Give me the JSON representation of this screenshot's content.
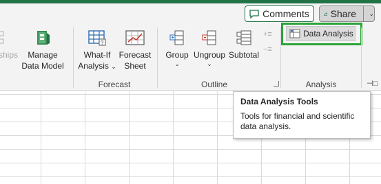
{
  "topbar": {
    "comments_label": "Comments",
    "share_label": "Share"
  },
  "ribbon": {
    "partial_label": "ships",
    "manage_line1": "Manage",
    "manage_line2": "Data Model",
    "whatif_line1": "What-If",
    "whatif_line2": "Analysis",
    "forecast_line1": "Forecast",
    "forecast_line2": "Sheet",
    "group_label": "Group",
    "ungroup_label": "Ungroup",
    "subtotal_label": "Subtotal",
    "data_analysis_label": "Data Analysis",
    "groups": {
      "forecast": "Forecast",
      "outline": "Outline",
      "analysis": "Analysis"
    }
  },
  "tooltip": {
    "title": "Data Analysis Tools",
    "body": "Tools for financial and scientific data analysis."
  },
  "colors": {
    "excel_green": "#217346",
    "highlight_green": "#2aa339",
    "ribbon_bg": "#f3f3f3"
  },
  "icons": [
    "comment-icon",
    "share-icon",
    "data-model-icon",
    "what-if-icon",
    "forecast-sheet-icon",
    "group-icon",
    "ungroup-icon",
    "subtotal-icon",
    "show-detail-icon",
    "hide-detail-icon",
    "data-analysis-icon",
    "dialog-launcher-icon",
    "pin-ribbon-icon"
  ]
}
